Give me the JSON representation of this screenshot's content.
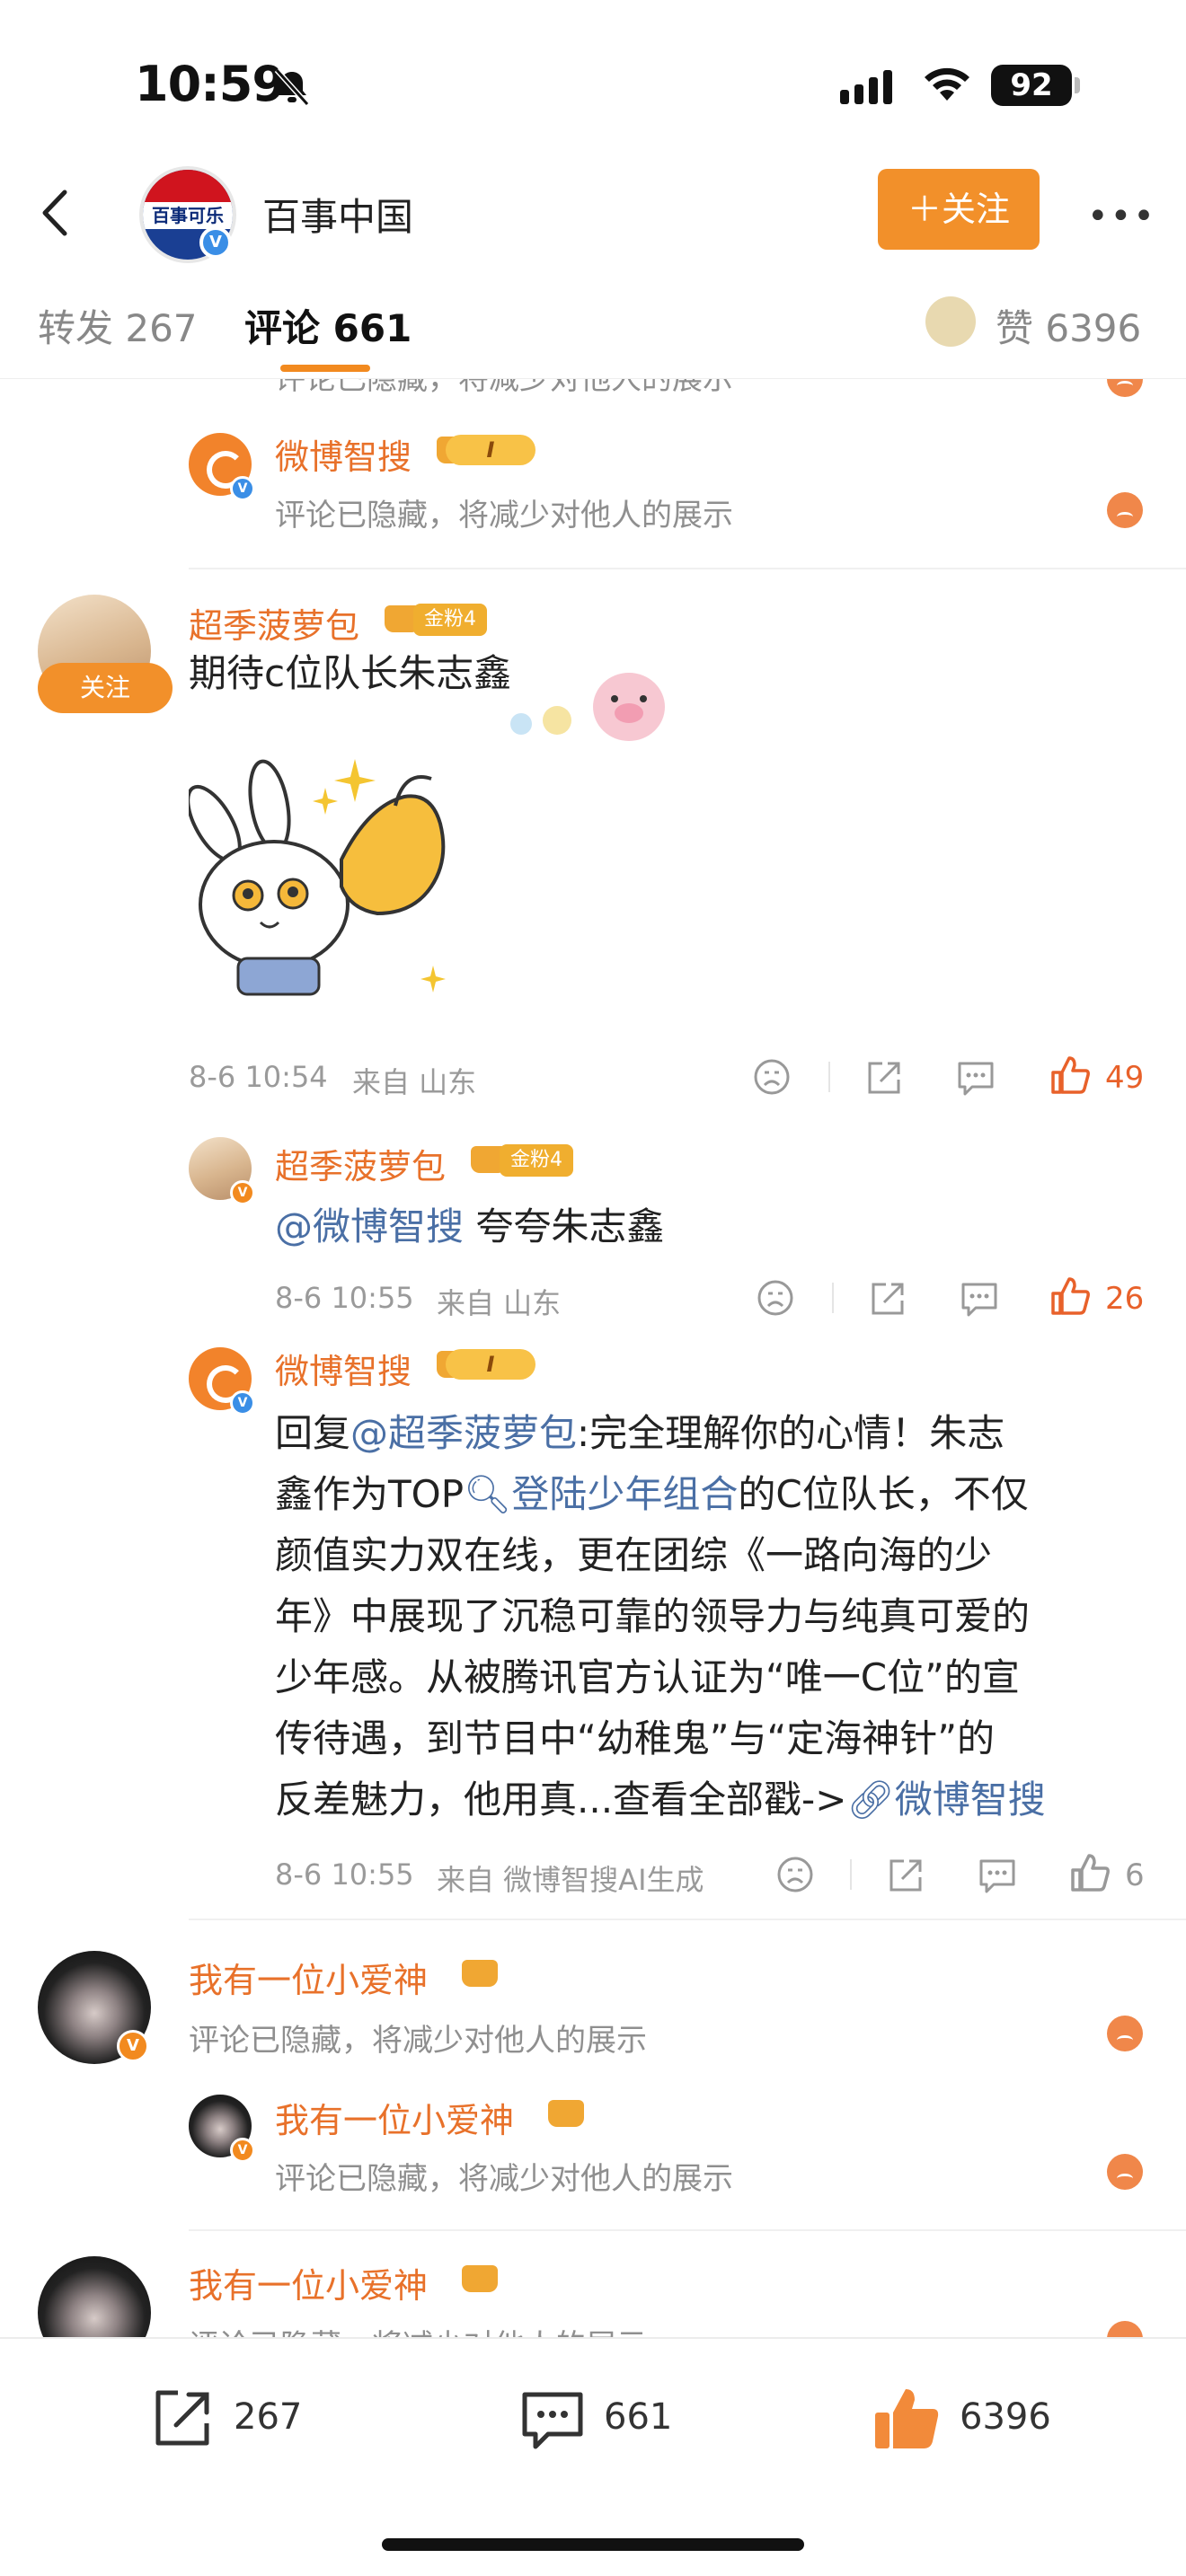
{
  "status_bar": {
    "time": "10:59",
    "battery": "92"
  },
  "header": {
    "title": "百事中国",
    "avatar_text": "百事可乐",
    "follow_label": "＋关注",
    "more_label": "•••"
  },
  "tabs": {
    "repost": "转发 267",
    "comment": "评论 661",
    "like": "赞 6396"
  },
  "comments": {
    "top_cut": "评论已隐藏，将减少对他人的展示",
    "reply_hidden": {
      "user": "微博智搜",
      "text": "评论已隐藏，将减少对他人的展示",
      "level_badge": "I"
    },
    "main": {
      "user": "超季菠萝包",
      "fan_badge": "金粉4",
      "follow_tag": "关注",
      "text": "期待c位队长朱志鑫",
      "date": "8-6 10:54",
      "location": "来自 山东",
      "likes": "49"
    },
    "reply1": {
      "user": "超季菠萝包",
      "fan_badge": "金粉4",
      "mention": "@微博智搜",
      "text": " 夸夸朱志鑫",
      "date": "8-6 10:55",
      "location": "来自 山东",
      "likes": "26"
    },
    "reply2": {
      "user": "微博智搜",
      "level_badge": "I",
      "prefix": "回复",
      "mention": "@超季菠萝包",
      "line1_rest": ":完全理解你的心情！朱志",
      "line2_pre": "鑫作为TOP",
      "line2_link": "登陆少年组合",
      "line2_post": "的C位队长，不仅",
      "line3": "颜值实力双在线，更在团综《一路向海的少",
      "line4": "年》中展现了沉稳可靠的领导力与纯真可爱的",
      "line5": "少年感。从被腾讯官方认证为“唯一C位”的宣",
      "line6": "传待遇，到节目中“幼稚鬼”与“定海神针”的",
      "line7_pre": "反差魅力，他用真...查看全部戳->",
      "line7_link": "微博智搜",
      "date": "8-6 10:55",
      "location": "来自 微博智搜AI生成",
      "likes": "6"
    },
    "c2": {
      "user": "我有一位小爱神",
      "text": "评论已隐藏，将减少对他人的展示"
    },
    "c2_reply": {
      "user": "我有一位小爱神",
      "text": "评论已隐藏，将减少对他人的展示"
    },
    "c3": {
      "user": "我有一位小爱神",
      "text": "评论已隐藏，将减少对他人的展示"
    }
  },
  "bottom_bar": {
    "repost": "267",
    "comment": "661",
    "like": "6396"
  },
  "colors": {
    "accent": "#f2902a",
    "username": "#e8712a",
    "link": "#4a6fa5",
    "like_active": "#e8612a"
  }
}
